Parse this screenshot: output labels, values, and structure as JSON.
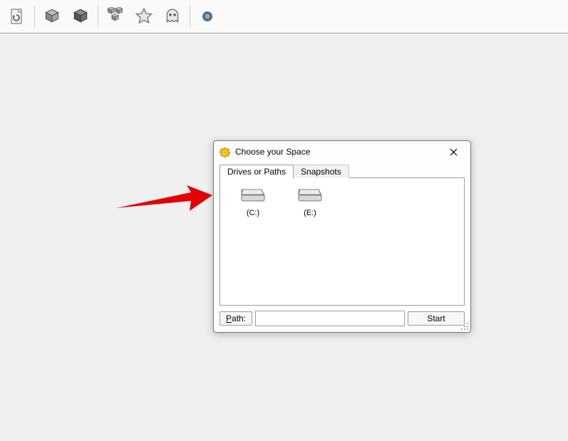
{
  "dialog": {
    "title": "Choose your Space",
    "tabs": [
      {
        "label": "Drives or Paths"
      },
      {
        "label": "Snapshots"
      }
    ],
    "drives": [
      {
        "label": "(C:)"
      },
      {
        "label": "(E:)"
      }
    ],
    "path_button": "Path:",
    "path_value": "",
    "start_button": "Start"
  }
}
